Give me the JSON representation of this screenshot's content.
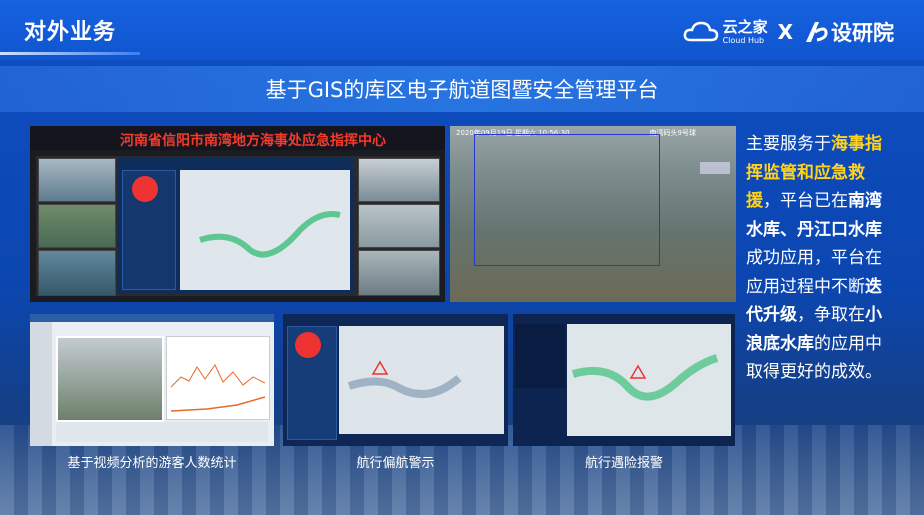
{
  "header": {
    "section_title": "对外业务",
    "brand": {
      "yunzhijia_cn": "云之家",
      "yunzhijia_en": "Cloud Hub",
      "separator": "X",
      "partner": "设研院"
    }
  },
  "banner": {
    "title": "基于GIS的库区电子航道图暨安全管理平台"
  },
  "command_center": {
    "title": "河南省信阳市南湾地方海事处应急指挥中心"
  },
  "camera": {
    "timestamp": "2020年09月19日 星期六 10:56:30",
    "name": "南湾码头9号球"
  },
  "captions": {
    "tourist_count": "基于视频分析的游客人数统计",
    "route_deviation": "航行偏航警示",
    "danger_alarm": "航行遇险报警"
  },
  "description": {
    "p1": "主要服务于",
    "h1": "海事指挥监管和应急救援",
    "p2": "，平台已在",
    "b1": "南湾水库、丹江口水库",
    "p3": "成功应用，平台在应用过程中不断",
    "b2": "迭代升级",
    "p4": "，争取在",
    "b3": "小浪底水库",
    "p5": "的应用中取得更好的成效。"
  },
  "colors": {
    "highlight": "#ffd21e",
    "command_title": "#f53a2a",
    "roi_box": "#2438d8"
  }
}
